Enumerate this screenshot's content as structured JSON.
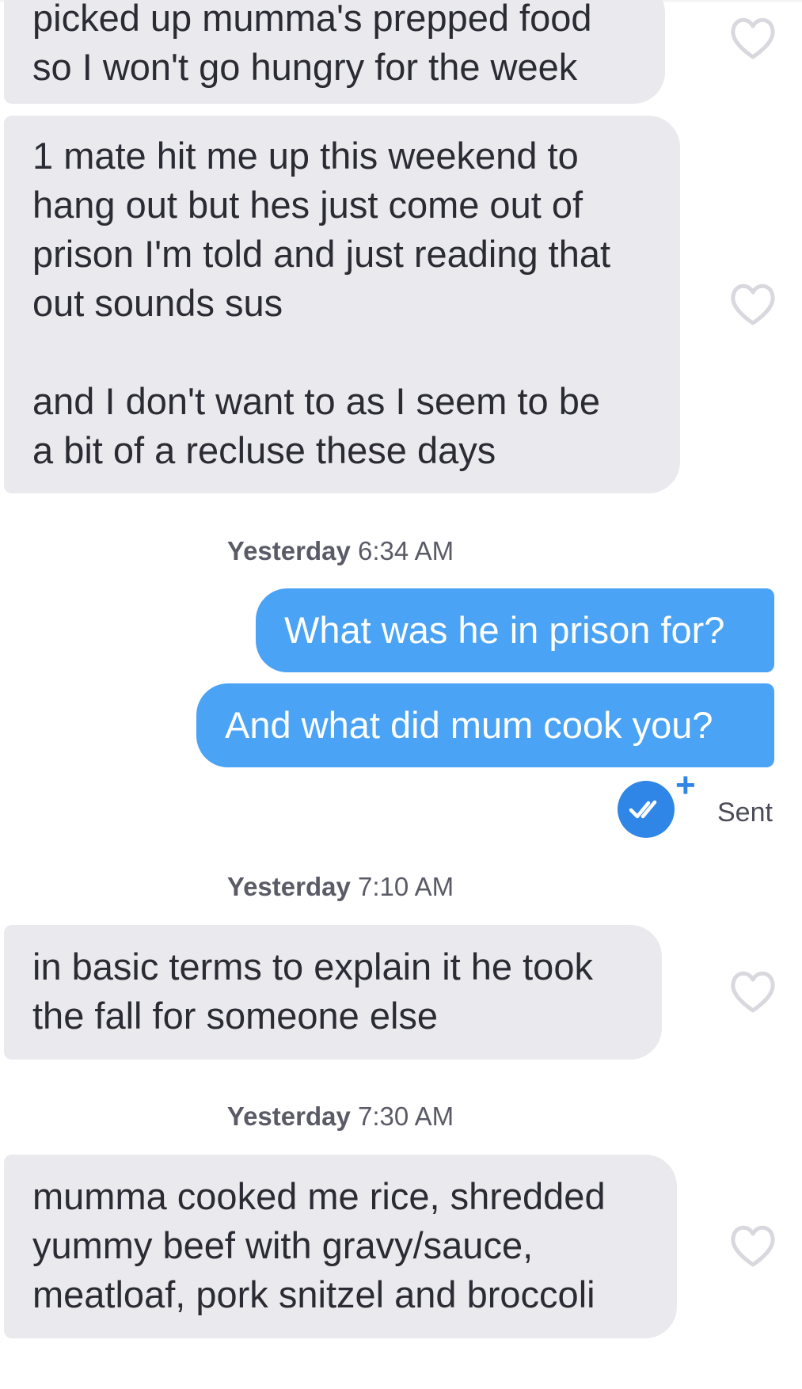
{
  "messages": [
    {
      "text": "picked up mumma's prepped food\nso I won't go hungry for the week"
    },
    {
      "text": "1 mate hit me up this weekend to\nhang out but hes just come out of\nprison I'm told and just reading that\nout sounds sus\n\nand I don't want to as I seem to be\na bit of a recluse these days"
    },
    {
      "text": "What was he in prison for?"
    },
    {
      "text": "And what did mum cook you?"
    },
    {
      "text": "in basic terms to explain it he took\nthe fall for someone else"
    },
    {
      "text": "mumma cooked me rice, shredded\nyummy beef with gravy/sauce,\nmeatloaf, pork snitzel and broccoli"
    }
  ],
  "timestamps": [
    {
      "day": "Yesterday",
      "time": "6:34 AM"
    },
    {
      "day": "Yesterday",
      "time": "7:10 AM"
    },
    {
      "day": "Yesterday",
      "time": "7:30 AM"
    }
  ],
  "status": {
    "label": "Sent",
    "plus": "+",
    "icon": "double-check-icon"
  },
  "colors": {
    "incoming_bubble": "#e9e9ee",
    "outgoing_bubble": "#4aa3f5",
    "read_receipt": "#2f86e6",
    "heart_outline": "#d8d8de"
  }
}
